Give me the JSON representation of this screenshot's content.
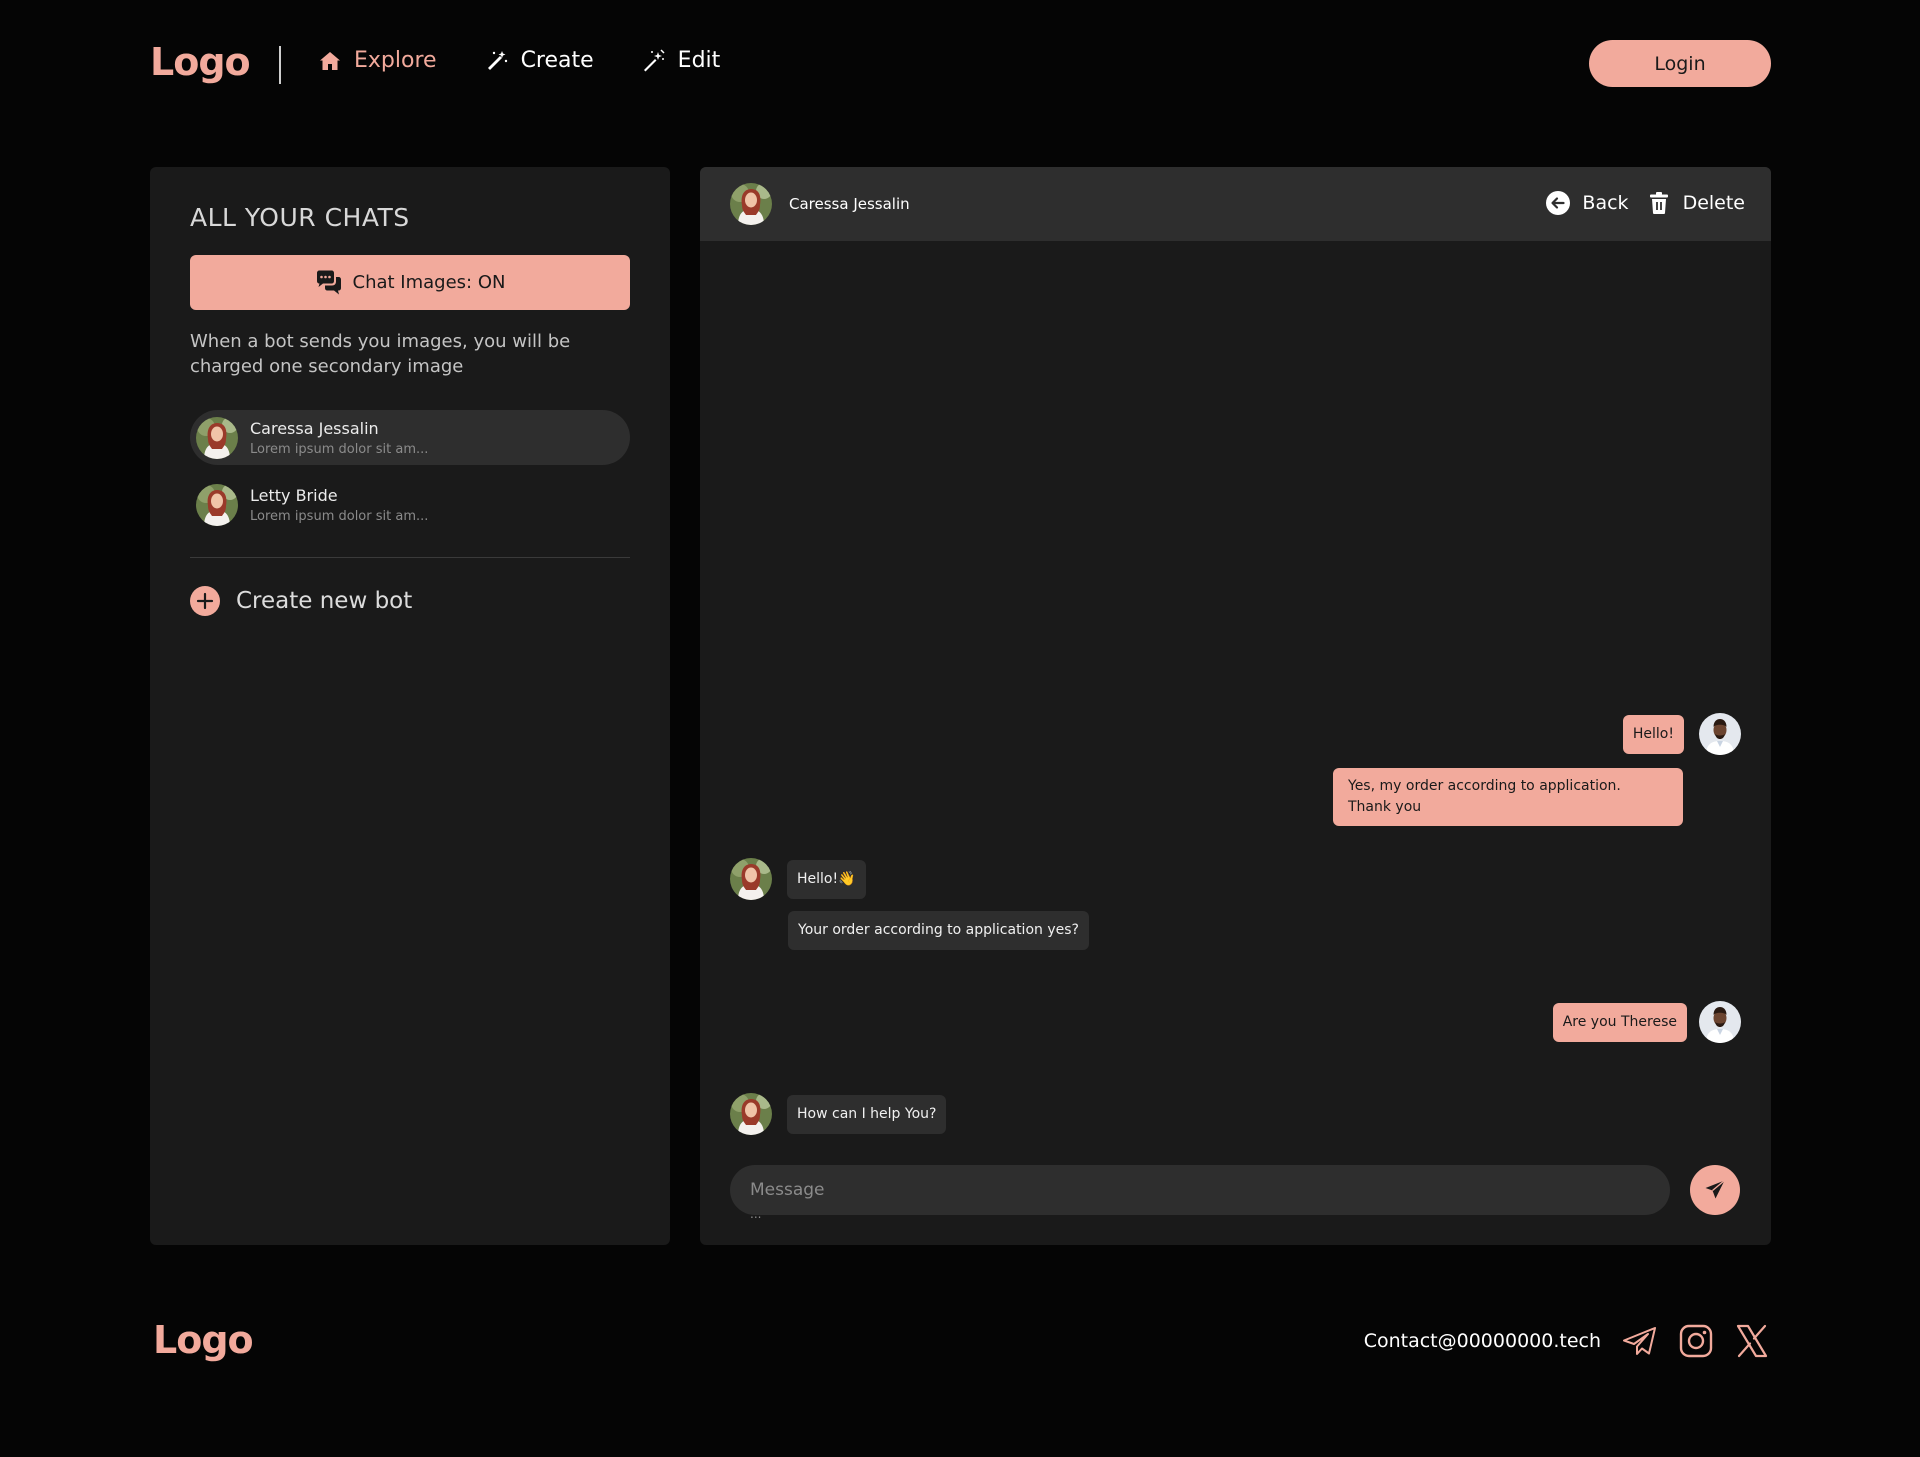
{
  "header": {
    "logo": "Logo",
    "nav": [
      {
        "label": "Explore",
        "icon": "home-icon",
        "active": true
      },
      {
        "label": "Create",
        "icon": "magic-wand-icon"
      },
      {
        "label": "Edit",
        "icon": "magic-stick-icon"
      }
    ],
    "login_label": "Login"
  },
  "sidebar": {
    "title": "ALL YOUR CHATS",
    "images_toggle_label": "Chat Images: ON",
    "images_note": "When a bot sends you images, you will be charged one secondary image",
    "chats": [
      {
        "name": "Caressa Jessalin",
        "preview": "Lorem ipsum dolor sit am...",
        "selected": true
      },
      {
        "name": "Letty Bride",
        "preview": "Lorem ipsum dolor sit am..."
      }
    ],
    "create_bot_label": "Create new bot"
  },
  "chat": {
    "contact_name": "Caressa Jessalin",
    "back_label": "Back",
    "delete_label": "Delete",
    "messages": [
      {
        "from": "user",
        "text": "Hello!"
      },
      {
        "from": "user",
        "text": "Yes, my order according to application. Thank you"
      },
      {
        "from": "bot",
        "text": "Hello!👋"
      },
      {
        "from": "bot",
        "text": "Your order according to application yes?"
      },
      {
        "from": "user",
        "text": "Are you Therese"
      },
      {
        "from": "bot",
        "text": "How can I help You?"
      }
    ],
    "composer_placeholder": "Message",
    "typing_indicator": "..."
  },
  "footer": {
    "logo": "Logo",
    "contact": "Contact@00000000.tech",
    "socials": [
      "telegram-icon",
      "instagram-icon",
      "x-icon"
    ]
  },
  "colors": {
    "accent": "#f2aa9c",
    "background": "#050505",
    "panel": "#1a1a1a",
    "panel_header": "#2e2e2e"
  }
}
